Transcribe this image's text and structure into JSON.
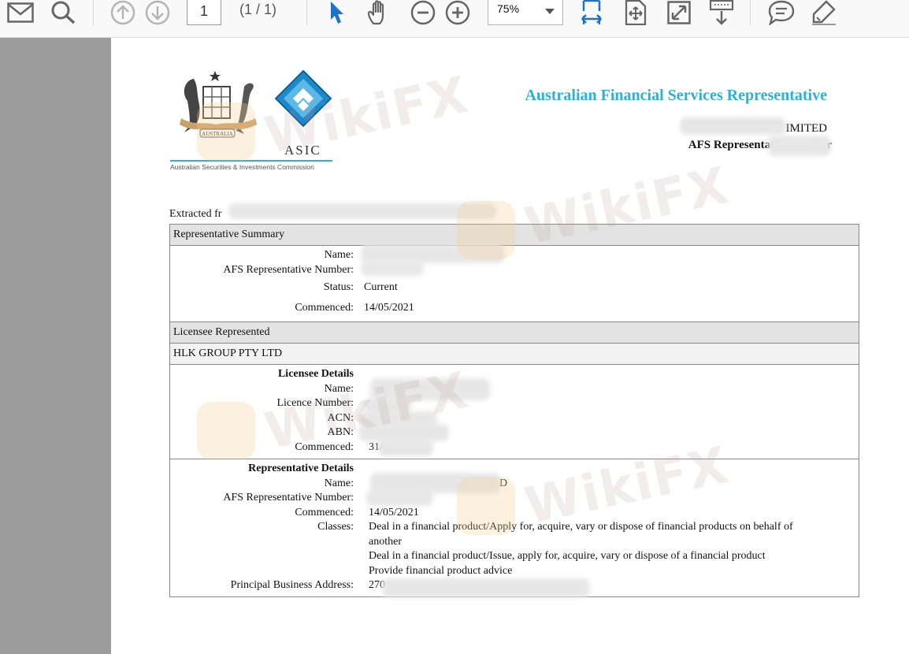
{
  "toolbar": {
    "icons": [
      "mail-icon",
      "search-icon",
      "page-up-icon",
      "page-down-icon",
      "select-tool-icon",
      "hand-tool-icon",
      "zoom-out-icon",
      "zoom-in-icon",
      "fit-width-icon",
      "fit-page-icon",
      "fullscreen-icon",
      "scroll-mode-icon",
      "comment-icon",
      "highlight-icon"
    ],
    "page_number": "1",
    "page_count": "(1 / 1)",
    "zoom": "75%"
  },
  "document": {
    "header": {
      "crest_text": "AUSTRALIA",
      "logo_word": "ASIC",
      "logo_sub": "Australian Securities & Investments Commission",
      "title": "Australian Financial Services Representative",
      "org_name": "T                              IMITED",
      "rep_number_label": "AFS Representative number"
    },
    "extracted": "Extracted fr",
    "rep_summary": {
      "header": "Representative Summary",
      "name_label": "Name:",
      "afs_label": "AFS  Representative Number:",
      "status_label": "Status:",
      "status": "Current",
      "commenced_label": "Commenced:",
      "commenced": "14/05/2021"
    },
    "licensee": {
      "header": "Licensee Represented",
      "name": "HLK GROUP PTY LTD",
      "details_title": "Licensee Details",
      "name_label": "Name:",
      "licence_label": "Licence Number:",
      "acn_label": "ACN:",
      "abn_label": "ABN:",
      "commenced_label": "Commenced:",
      "commenced_partial": "31/"
    },
    "rep_details": {
      "title": "Representative Details",
      "name_label": "Name:",
      "name_tail": "D",
      "afs_label": "AFS Representative Number:",
      "commenced_label": "Commenced:",
      "commenced": "14/05/2021",
      "classes_label": "Classes:",
      "classes": [
        "Deal in a financial product/Apply for, acquire, vary or dispose of financial products on behalf of",
        "another",
        "Deal in a financial product/Issue, apply for, acquire, vary or dispose of a financial product",
        "Provide financial product advice"
      ],
      "address_label": "Principal Business Address:",
      "address_partial": "270"
    }
  },
  "watermark": "WikiFX",
  "colors": {
    "accent": "#2bb1d8",
    "asic_blue": "#1e88c8",
    "gutter": "#9b9b9b"
  }
}
